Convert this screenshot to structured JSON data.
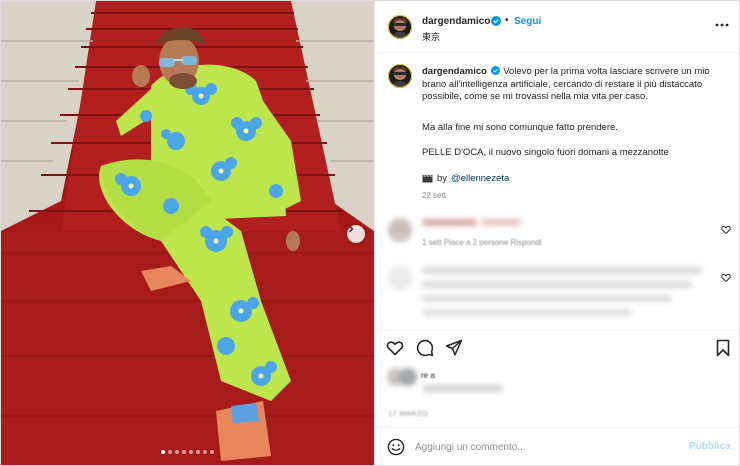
{
  "post": {
    "username": "dargendamico",
    "follow_label": "Segui",
    "separator": "•",
    "location": "東京",
    "more_icon": "more-horizontal-icon"
  },
  "caption": {
    "username": "dargendamico",
    "text": "Volevo per la prima volta lasciare scrivere un mio brano all'intelligenza artificiale, cercando di restare il più distaccato possibile, come se mi trovassi nella mia vita per caso.",
    "line2": "Ma alla fine mi sono comunque fatto prendere.",
    "line3": "PELLE D'OCA, il nuovo singolo fuori domani a mezzanotte",
    "credit_prefix": "by",
    "credit_handle": "@ellennezeta",
    "time": "22 sett"
  },
  "comments": [
    {
      "meta": "1 sett   Piace a 2 persone   Rispondi",
      "blurred": true
    },
    {
      "blurred": true
    }
  ],
  "likes": {
    "line1": "re a"
  },
  "post_time": "17 MARZO",
  "add_comment": {
    "placeholder": "Aggiungi un commento...",
    "publish_label": "Pubblica"
  },
  "carousel": {
    "count": 8,
    "active": 0
  },
  "colors": {
    "accent": "#0095f6",
    "verified": "#0095f6",
    "publish_disabled": "#b3dbff",
    "carpet": "#b51e1e",
    "tracksuit": "#b9e54a",
    "flowers": "#4aa6e8"
  }
}
